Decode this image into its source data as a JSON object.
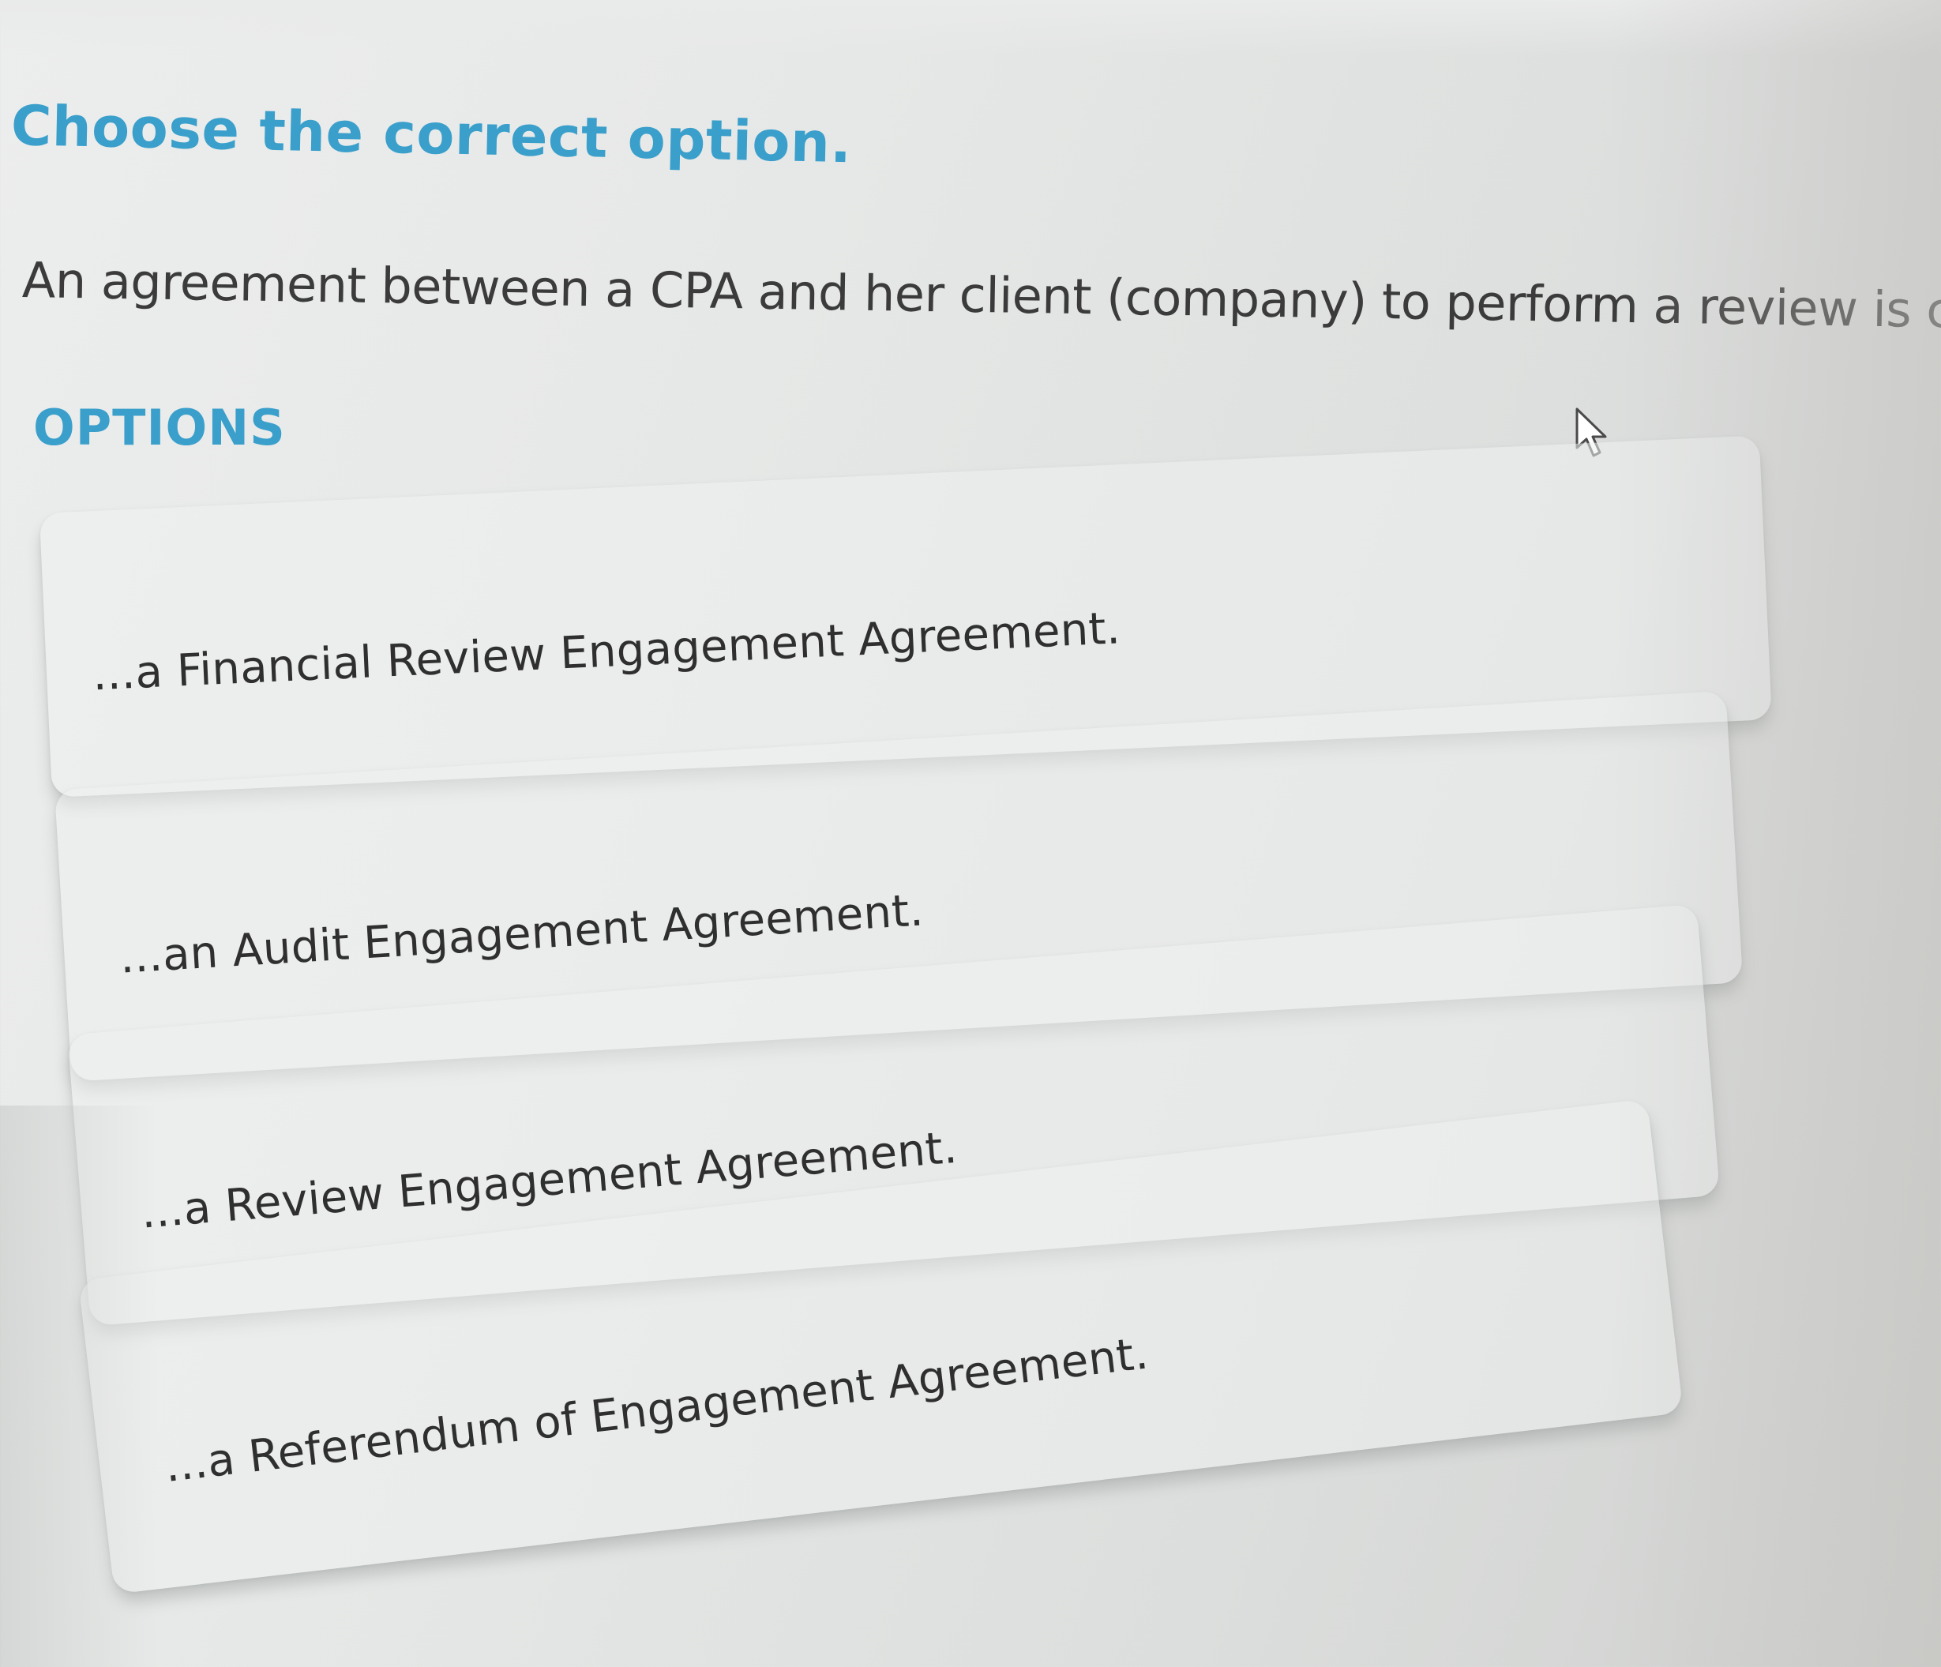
{
  "question_panel": {
    "heading": "Choose the correct option.",
    "question": "An agreement between a CPA and her client (company) to perform a review is called...",
    "options_label": "OPTIONS",
    "options": [
      {
        "label": "...a Financial Review Engagement Agreement."
      },
      {
        "label": "...an Audit Engagement Agreement."
      },
      {
        "label": "...a Review Engagement Agreement."
      },
      {
        "label": "...a Referendum of Engagement Agreement."
      }
    ]
  },
  "theme": {
    "accent_color": "#3a9fcb",
    "text_color": "#3b3b3b",
    "card_color": "#eef1f0"
  },
  "icons": {
    "cursor": "mouse-pointer-arrow-icon"
  }
}
